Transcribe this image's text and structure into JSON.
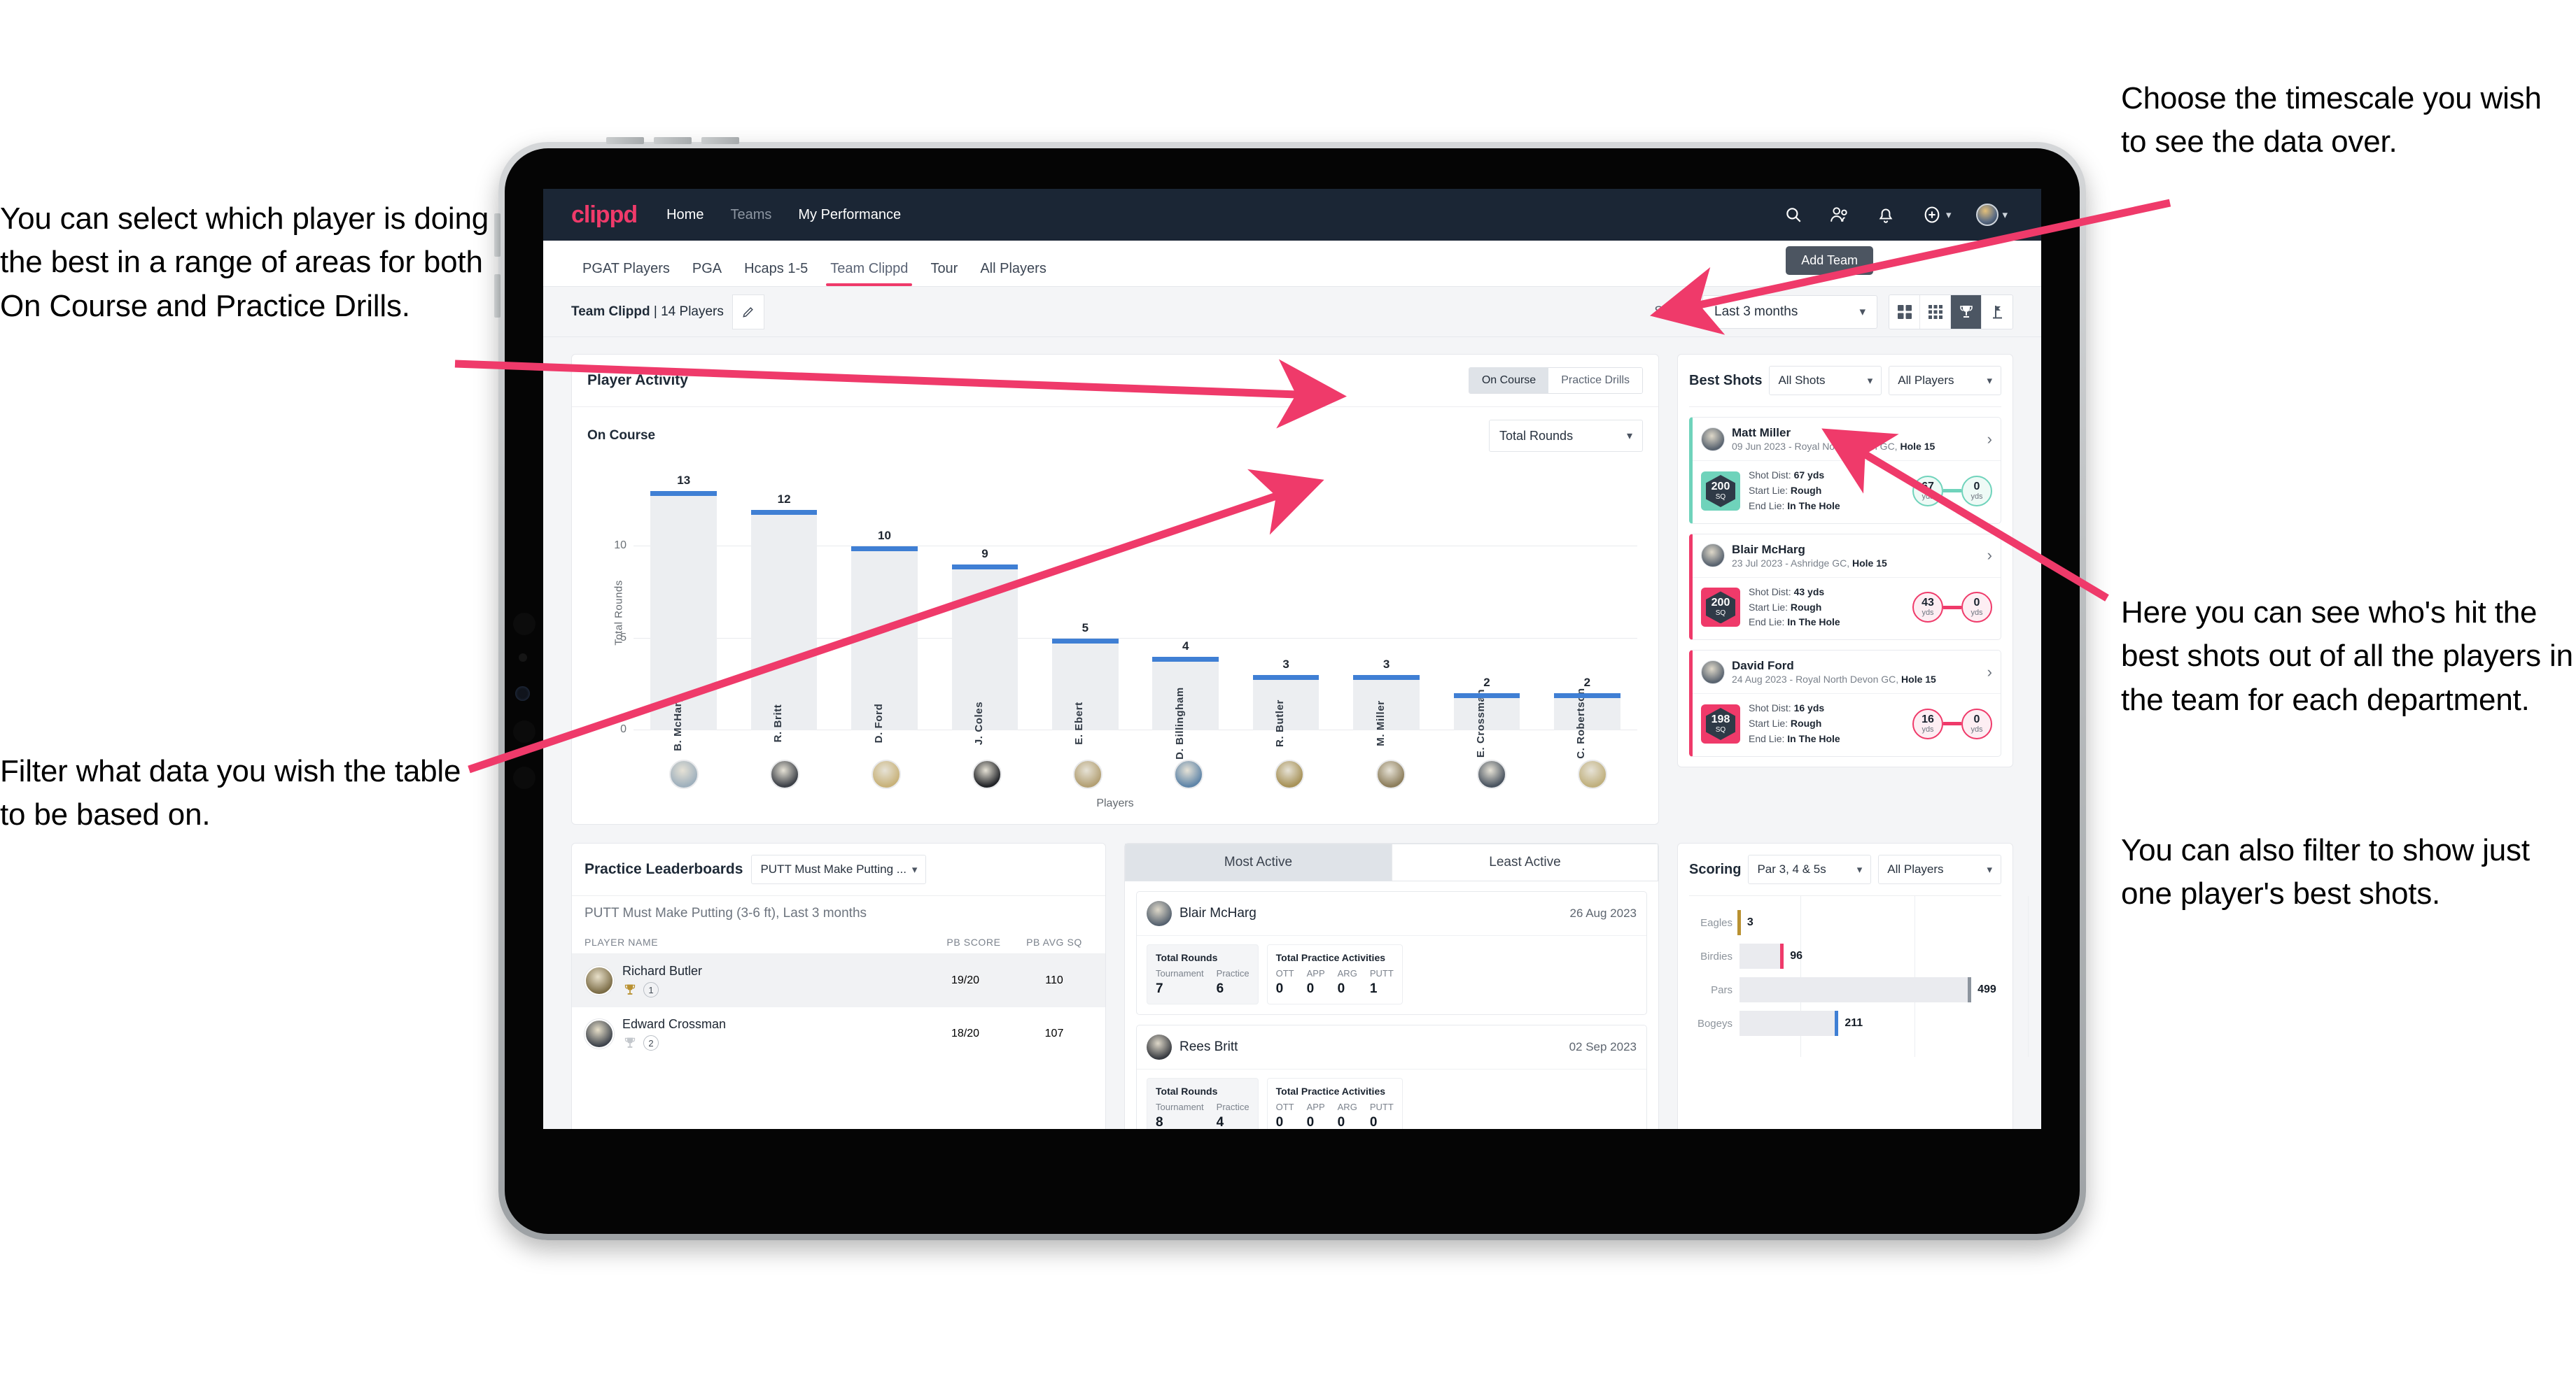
{
  "annotations": {
    "left_top": "You can select which player is doing the best in a range of areas for both On Course and Practice Drills.",
    "left_bottom": "Filter what data you wish the table to be based on.",
    "right_top": "Choose the timescale you wish to see the data over.",
    "right_middle": "Here you can see who's hit the best shots out of all the players in the team for each department.",
    "right_bottom": "You can also filter to show just one player's best shots."
  },
  "colors": {
    "brand_pink": "#ef3a6a",
    "navy": "#1b2635",
    "bar_blue": "#3f7fd4",
    "teal": "#6fd3bb",
    "gold": "#b99131"
  },
  "topbar": {
    "logo": "clippd",
    "nav": [
      {
        "label": "Home",
        "dim": false
      },
      {
        "label": "Teams",
        "dim": true
      },
      {
        "label": "My Performance",
        "dim": false
      }
    ],
    "icons": [
      "search-icon",
      "people-icon",
      "bell-icon",
      "plus-circle-icon",
      "avatar"
    ]
  },
  "tabs": {
    "items": [
      {
        "label": "PGAT Players",
        "active": false
      },
      {
        "label": "PGA",
        "active": false
      },
      {
        "label": "Hcaps 1-5",
        "active": false
      },
      {
        "label": "Team Clippd",
        "active": true
      },
      {
        "label": "Tour",
        "active": false
      },
      {
        "label": "All Players",
        "active": false
      }
    ],
    "tooltip": "Add Team"
  },
  "subbar": {
    "team_label": "Team Clippd",
    "team_count": " | 14 Players",
    "edit_icon": "pencil-icon",
    "show_label": "Show:",
    "timescale": "Last 3 months",
    "views": [
      {
        "icon": "grid-4-icon",
        "active": false
      },
      {
        "icon": "grid-9-icon",
        "active": false
      },
      {
        "icon": "trophy-icon",
        "active": true
      },
      {
        "icon": "golf-flag-icon",
        "active": false
      }
    ]
  },
  "player_activity": {
    "title": "Player Activity",
    "segments": [
      {
        "label": "On Course",
        "active": true
      },
      {
        "label": "Practice Drills",
        "active": false
      }
    ],
    "sub_title": "On Course",
    "metric_select": "Total Rounds",
    "x_axis_label": "Players"
  },
  "chart_data": [
    {
      "type": "bar",
      "title": "Player Activity - On Course",
      "categories": [
        "B. McHarg",
        "R. Britt",
        "D. Ford",
        "J. Coles",
        "E. Ebert",
        "D. Billingham",
        "R. Butler",
        "M. Miller",
        "E. Crossman",
        "C. Robertson"
      ],
      "values": [
        13,
        12,
        10,
        9,
        5,
        4,
        3,
        3,
        2,
        2
      ],
      "xlabel": "Players",
      "ylabel": "Total Rounds",
      "ylim": [
        0,
        14
      ],
      "yticks": [
        0,
        5,
        10
      ],
      "grid": true,
      "legend": "none"
    },
    {
      "type": "bar",
      "orientation": "horizontal",
      "title": "Scoring",
      "categories": [
        "Eagles",
        "Birdies",
        "Pars",
        "Bogeys"
      ],
      "values": [
        3,
        96,
        499,
        211
      ],
      "xlabel": "",
      "ylabel": "",
      "xlim": [
        0,
        700
      ],
      "grid": true,
      "legend": "none"
    }
  ],
  "best_shots": {
    "title": "Best Shots",
    "filter_shots": "All Shots",
    "filter_players": "All Players",
    "cards": [
      {
        "name": "Matt Miller",
        "meta_date": "09 Jun 2023 - Royal North Devon GC, ",
        "meta_hole": "Hole 15",
        "sq": "200",
        "sq_unit": "SQ",
        "shot_dist_label": "Shot Dist: ",
        "shot_dist": "67 yds",
        "start_lie_label": "Start Lie: ",
        "start_lie": "Rough",
        "end_lie_label": "End Lie: ",
        "end_lie": "In The Hole",
        "from_val": "67",
        "from_unit": "yds",
        "to_val": "0",
        "to_unit": "yds",
        "accent": "#6fd3bb",
        "tint": "#eefaf6",
        "chip": "#6fd3bb"
      },
      {
        "name": "Blair McHarg",
        "meta_date": "23 Jul 2023 - Ashridge GC, ",
        "meta_hole": "Hole 15",
        "sq": "200",
        "sq_unit": "SQ",
        "shot_dist_label": "Shot Dist: ",
        "shot_dist": "43 yds",
        "start_lie_label": "Start Lie: ",
        "start_lie": "Rough",
        "end_lie_label": "End Lie: ",
        "end_lie": "In The Hole",
        "from_val": "43",
        "from_unit": "yds",
        "to_val": "0",
        "to_unit": "yds",
        "accent": "#ef3a6a",
        "tint": "#fdeef3",
        "chip": "#ef3a6a"
      },
      {
        "name": "David Ford",
        "meta_date": "24 Aug 2023 - Royal North Devon GC, ",
        "meta_hole": "Hole 15",
        "sq": "198",
        "sq_unit": "SQ",
        "shot_dist_label": "Shot Dist: ",
        "shot_dist": "16 yds",
        "start_lie_label": "Start Lie: ",
        "start_lie": "Rough",
        "end_lie_label": "End Lie: ",
        "end_lie": "In The Hole",
        "from_val": "16",
        "from_unit": "yds",
        "to_val": "0",
        "to_unit": "yds",
        "accent": "#ef3a6a",
        "tint": "#fdeef3",
        "chip": "#ef3a6a"
      }
    ]
  },
  "practice_leaderboards": {
    "title": "Practice Leaderboards",
    "drill_select": "PUTT Must Make Putting ...",
    "sub_title": "PUTT Must Make Putting (3-6 ft),",
    "sub_period": " Last 3 months",
    "columns": [
      "PLAYER NAME",
      "PB SCORE",
      "PB AVG SQ"
    ],
    "rows": [
      {
        "name": "Richard Butler",
        "rank": "1",
        "pb_score": "19/20",
        "pb_avg_sq": "110",
        "trophy": "gold"
      },
      {
        "name": "Edward Crossman",
        "rank": "2",
        "pb_score": "18/20",
        "pb_avg_sq": "107",
        "trophy": "silver"
      }
    ]
  },
  "activity": {
    "tabs": [
      {
        "label": "Most Active",
        "active": true
      },
      {
        "label": "Least Active",
        "active": false
      }
    ],
    "cards": [
      {
        "name": "Blair McHarg",
        "date": "26 Aug 2023",
        "rounds_title": "Total Rounds",
        "rounds": [
          {
            "key": "Tournament",
            "value": "7"
          },
          {
            "key": "Practice",
            "value": "6"
          }
        ],
        "practice_title": "Total Practice Activities",
        "practice": [
          {
            "key": "OTT",
            "value": "0"
          },
          {
            "key": "APP",
            "value": "0"
          },
          {
            "key": "ARG",
            "value": "0"
          },
          {
            "key": "PUTT",
            "value": "1"
          }
        ]
      },
      {
        "name": "Rees Britt",
        "date": "02 Sep 2023",
        "rounds_title": "Total Rounds",
        "rounds": [
          {
            "key": "Tournament",
            "value": "8"
          },
          {
            "key": "Practice",
            "value": "4"
          }
        ],
        "practice_title": "Total Practice Activities",
        "practice": [
          {
            "key": "OTT",
            "value": "0"
          },
          {
            "key": "APP",
            "value": "0"
          },
          {
            "key": "ARG",
            "value": "0"
          },
          {
            "key": "PUTT",
            "value": "0"
          }
        ]
      }
    ]
  },
  "scoring": {
    "title": "Scoring",
    "filter_par": "Par 3, 4 & 5s",
    "filter_players": "All Players",
    "bars": [
      {
        "label": "Eagles",
        "value": "3",
        "pct": 0.5,
        "color": "#b99131"
      },
      {
        "label": "Birdies",
        "value": "96",
        "pct": 17,
        "color": "#ef3a6a"
      },
      {
        "label": "Pars",
        "value": "499",
        "pct": 89,
        "color": "#8c949e"
      },
      {
        "label": "Bogeys",
        "value": "211",
        "pct": 38,
        "color": "#3f7fd4"
      }
    ]
  }
}
